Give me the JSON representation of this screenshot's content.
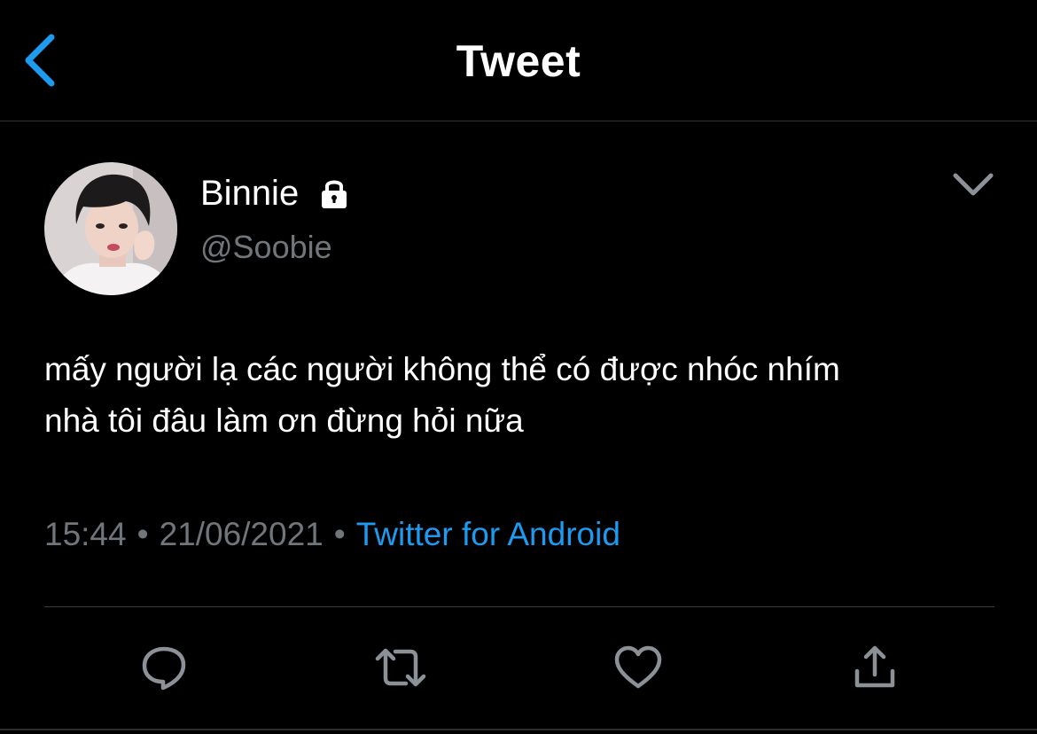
{
  "header": {
    "title": "Tweet",
    "back_icon": "chevron-left-icon",
    "accent_color": "#1d9bf0"
  },
  "tweet": {
    "author": {
      "display_name": "Binnie",
      "handle": "@Soobie",
      "protected_icon": "lock-icon",
      "avatar": "profile-photo"
    },
    "more_icon": "chevron-down-icon",
    "text_lines": [
      "mấy người lạ các người không thể có được nhóc nhím",
      "nhà tôi đâu làm ơn đừng hỏi nữa"
    ],
    "meta": {
      "time": "15:44",
      "separator": "•",
      "date": "21/06/2021",
      "source": "Twitter for Android"
    }
  },
  "actions": [
    {
      "name": "reply",
      "icon": "reply-icon"
    },
    {
      "name": "retweet",
      "icon": "retweet-icon"
    },
    {
      "name": "like",
      "icon": "heart-icon"
    },
    {
      "name": "share",
      "icon": "share-icon"
    }
  ],
  "colors": {
    "background": "#000000",
    "text": "#ffffff",
    "secondary_text": "#71767b",
    "link": "#1d9bf0",
    "divider": "#2f3336"
  }
}
